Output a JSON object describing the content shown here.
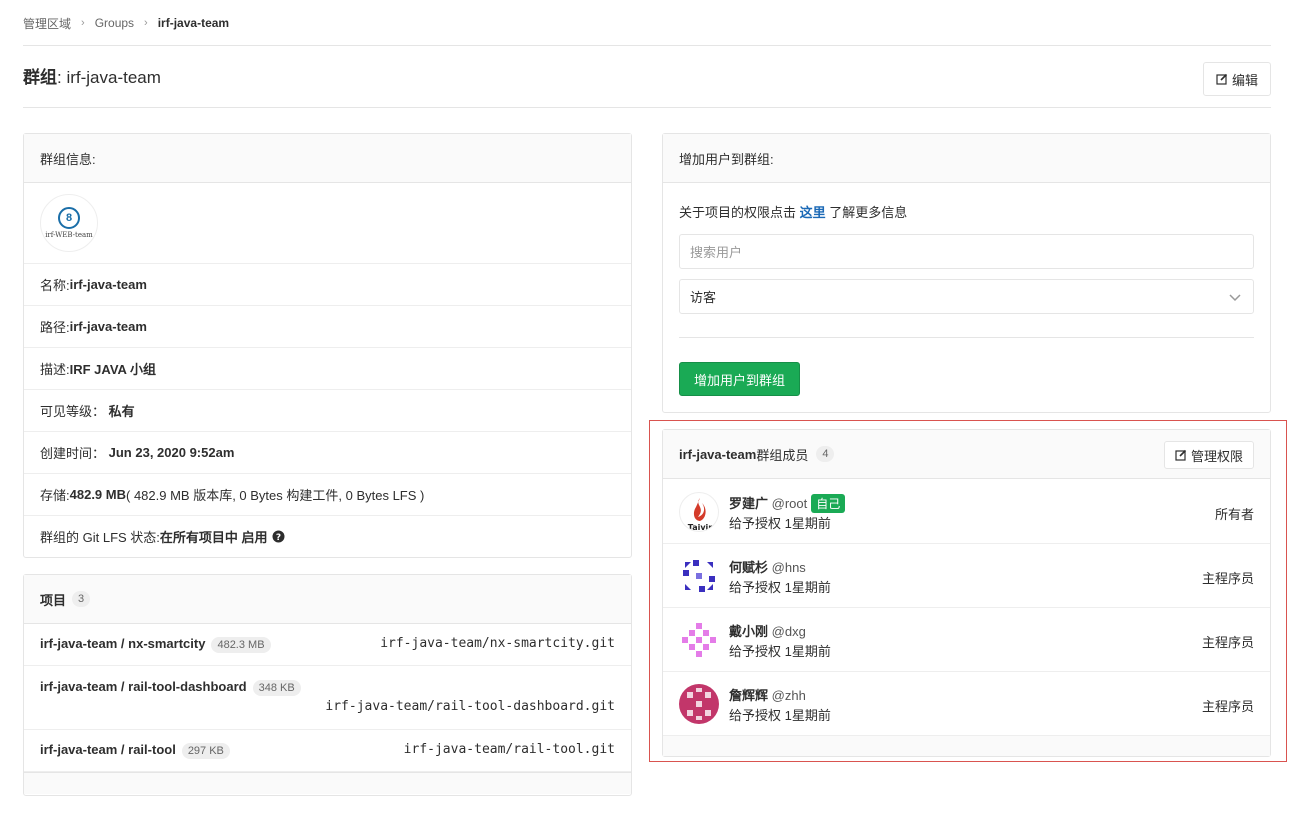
{
  "breadcrumb": {
    "root": "管理区域",
    "groups": "Groups",
    "current": "irf-java-team"
  },
  "title": {
    "prefix": "群组",
    "name": ": irf-java-team"
  },
  "edit_button": "编辑",
  "group_info": {
    "heading": "群组信息:",
    "logo_text": "irf-WEB-team",
    "name_label": "名称: ",
    "name_value": "irf-java-team",
    "path_label": "路径: ",
    "path_value": "irf-java-team",
    "desc_label": "描述: ",
    "desc_value": "IRF JAVA 小组",
    "visibility_label": "可见等级：",
    "visibility_value": "私有",
    "created_label": "创建时间：",
    "created_value": "Jun 23, 2020 9:52am",
    "storage_label": "存储: ",
    "storage_value": "482.9 MB",
    "storage_detail": " ( 482.9 MB 版本库, 0 Bytes 构建工件, 0 Bytes LFS )",
    "lfs_label": "群组的 Git LFS 状态: ",
    "lfs_value": "在所有项目中 启用"
  },
  "projects": {
    "heading": "项目",
    "count": "3",
    "items": [
      {
        "name": "irf-java-team / nx-smartcity",
        "size": "482.3 MB",
        "repo": "irf-java-team/nx-smartcity.git"
      },
      {
        "name": "irf-java-team / rail-tool-dashboard",
        "size": "348 KB",
        "repo": "irf-java-team/rail-tool-dashboard.git"
      },
      {
        "name": "irf-java-team / rail-tool",
        "size": "297 KB",
        "repo": "irf-java-team/rail-tool.git"
      }
    ]
  },
  "add_user": {
    "heading": "增加用户到群组:",
    "info_prefix": "关于项目的权限点击 ",
    "info_link": "这里",
    "info_suffix": " 了解更多信息",
    "search_placeholder": "搜索用户",
    "role_selected": "访客",
    "submit": "增加用户到群组"
  },
  "members": {
    "group_name": "irf-java-team",
    "heading_suffix": " 群组成员",
    "count": "4",
    "manage_button": "管理权限",
    "items": [
      {
        "name": "罗建广",
        "username": "@root",
        "self": "自己",
        "granted": "给予授权 1星期前",
        "role": "所有者"
      },
      {
        "name": "何赋杉",
        "username": "@hns",
        "granted": "给予授权 1星期前",
        "role": "主程序员"
      },
      {
        "name": "戴小刚",
        "username": "@dxg",
        "granted": "给予授权 1星期前",
        "role": "主程序员"
      },
      {
        "name": "詹辉辉",
        "username": "@zhh",
        "granted": "给予授权 1星期前",
        "role": "主程序员"
      }
    ]
  },
  "colors": {
    "accent_green": "#1aaa55",
    "link_blue": "#1b69b6",
    "highlight_red": "#d9534f"
  }
}
